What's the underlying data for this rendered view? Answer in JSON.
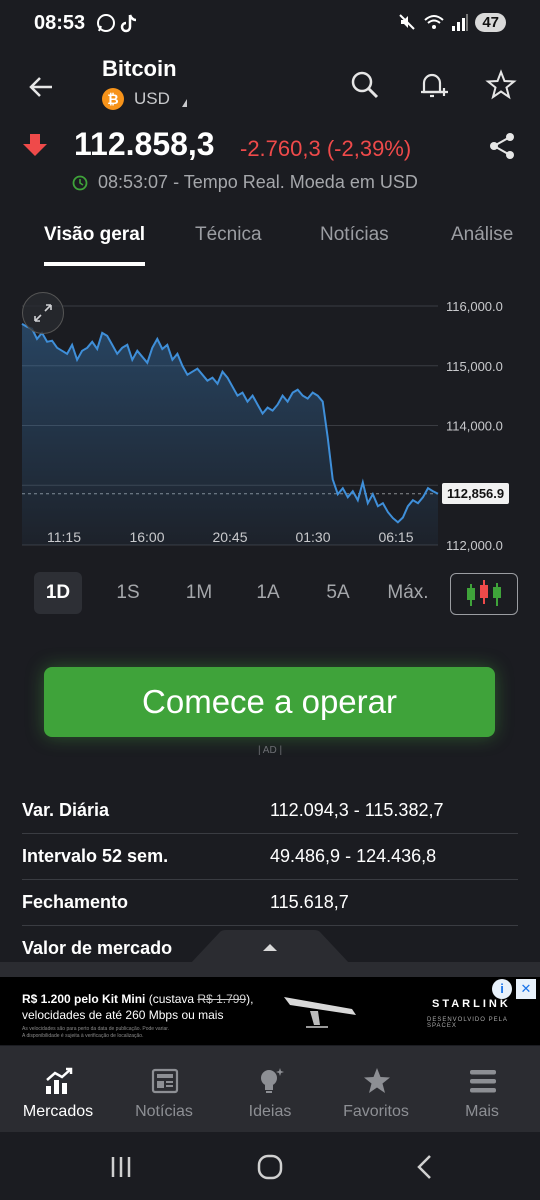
{
  "status": {
    "time": "08:53",
    "battery": "47"
  },
  "header": {
    "title": "Bitcoin",
    "currency": "USD",
    "coin_symbol": "₿"
  },
  "quote": {
    "price": "112.858,3",
    "change": "-2.760,3 (-2,39%)",
    "timestamp": "08:53:07 - Tempo Real. Moeda em USD",
    "direction": "down",
    "change_color": "#ef4a4a"
  },
  "tabs": [
    "Visão geral",
    "Técnica",
    "Notícias",
    "Análise"
  ],
  "chart_data": {
    "type": "area",
    "x_ticks": [
      "11:15",
      "16:00",
      "20:45",
      "01:30",
      "06:15"
    ],
    "y_ticks": [
      "116,000.0",
      "115,000.0",
      "114,000.0",
      "112,856.9",
      "112,000.0"
    ],
    "current_value_label": "112,856.9",
    "ylim": [
      112000,
      116000
    ],
    "values": [
      115700,
      115650,
      115620,
      115450,
      115550,
      115400,
      115420,
      115300,
      115250,
      115200,
      115350,
      115100,
      115250,
      115300,
      115400,
      115280,
      115550,
      115500,
      115350,
      115200,
      115300,
      115350,
      115100,
      115250,
      115150,
      115050,
      115300,
      115450,
      115280,
      115350,
      115100,
      115200,
      115000,
      114850,
      114900,
      114950,
      114850,
      114750,
      114800,
      114700,
      114900,
      114800,
      114650,
      114500,
      114550,
      114400,
      114500,
      114350,
      114200,
      114300,
      114250,
      114350,
      114500,
      114400,
      114550,
      114600,
      114500,
      114450,
      114550,
      114500,
      114400,
      113800,
      113100,
      112850,
      112950,
      112800,
      112900,
      112750,
      113050,
      112700,
      112850,
      112650,
      112700,
      112550,
      112450,
      112380,
      112460,
      112650,
      112750,
      112700,
      112800,
      112950,
      112900,
      112857
    ],
    "line_color": "#3f8fd9",
    "grid": true
  },
  "ranges": [
    "1D",
    "1S",
    "1M",
    "1A",
    "5A",
    "Máx."
  ],
  "active_range": "1D",
  "cta": {
    "label": "Comece a operar",
    "ad_note": "| AD |",
    "color": "#3fa33a"
  },
  "stats": [
    {
      "label": "Var. Diária",
      "value": "112.094,3 - 115.382,7"
    },
    {
      "label": "Intervalo 52 sem.",
      "value": "49.486,9 - 124.436,8"
    },
    {
      "label": "Fechamento",
      "value": "115.618,7"
    },
    {
      "label": "Valor de mercado",
      "value": ""
    }
  ],
  "ad": {
    "headline_bold": "R$ 1.200 pelo Kit Mini",
    "headline_rest": " (custava ",
    "old_price": "R$ 1.799",
    "headline_close": "),",
    "line2": "velocidades de até 260 Mbps ou mais",
    "fine1": "As velocidades são para perto da data de publicação. Pode variar.",
    "fine2": "A disponibilidade é sujeita à verificação de localização.",
    "brand": "STARLINK",
    "brand_sub": "DESENVOLVIDO PELA SPACEX",
    "info": "i",
    "close": "✕"
  },
  "bottom_nav": [
    {
      "label": "Mercados",
      "icon": "markets-chart-icon",
      "active": true
    },
    {
      "label": "Notícias",
      "icon": "newspaper-icon",
      "active": false
    },
    {
      "label": "Ideias",
      "icon": "lightbulb-icon",
      "active": false
    },
    {
      "label": "Favoritos",
      "icon": "star-icon",
      "active": false
    },
    {
      "label": "Mais",
      "icon": "menu-icon",
      "active": false
    }
  ]
}
